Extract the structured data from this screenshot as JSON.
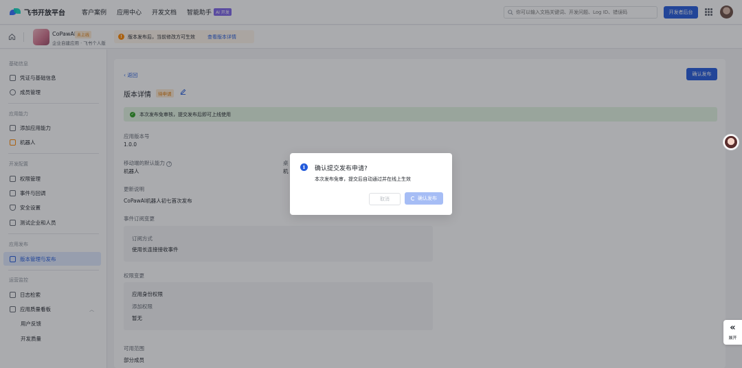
{
  "topbar": {
    "logo_text": "飞书开放平台",
    "nav": [
      "客户案例",
      "应用中心",
      "开发文档",
      "智能助手"
    ],
    "ai_badge": "AI 开发",
    "search_placeholder": "你可以输入文档关键词、开发问题、Log ID、错误码",
    "dev_console": "开发者后台"
  },
  "appbar": {
    "app_name": "CoPawAI",
    "app_status": "未上线",
    "app_subtitle": "企业自建应用 · 飞书个人版",
    "notice_text": "版本发布后，当前修改方可生效",
    "notice_link": "查看版本详情"
  },
  "sidebar": {
    "groups": [
      "基础信息",
      "应用能力",
      "开发配置",
      "应用发布",
      "运营监控"
    ],
    "items": {
      "credentials": "凭证与基础信息",
      "members": "成员管理",
      "add_capability": "添加应用能力",
      "bot": "机器人",
      "permissions": "权限管理",
      "events": "事件与回调",
      "security": "安全设置",
      "test_enterprise": "测试企业和人员",
      "version": "版本管理与发布",
      "logs": "日志检索",
      "quality": "应用质量看板",
      "feedback": "用户反馈",
      "dev_quality": "开发质量"
    }
  },
  "content": {
    "back": "返回",
    "confirm_publish": "确认发布",
    "title": "版本详情",
    "status": "待申请",
    "banner": "本次发布免审核，提交发布后即可上线使用",
    "version_label": "应用版本号",
    "version_value": "1.0.0",
    "mobile_label": "移动端的默认能力",
    "mobile_value": "机器人",
    "desktop_label_fragment": "桌",
    "desktop_value_fragment": "机",
    "changelog_label": "更新说明",
    "changelog_value": "CoPawAI机器人初七首次发布",
    "event_label": "事件订阅变更",
    "event_box_label": "订阅方式",
    "event_box_value": "使用长连接接收事件",
    "perm_label": "权限变更",
    "perm_box_title": "应用身份权限",
    "perm_box_label": "添加权限",
    "perm_box_value": "暂无",
    "scope_label": "可用范围",
    "scope_value": "部分成员"
  },
  "dialog": {
    "title": "确认提交发布申请?",
    "body": "本次发布免审，提交后自动通过并在线上生效",
    "cancel": "取消",
    "confirm": "确认发布"
  },
  "float": {
    "expand_label": "展开"
  },
  "colors": {
    "primary": "#245bdb",
    "warning": "#ff8800",
    "success": "#2ea121"
  }
}
